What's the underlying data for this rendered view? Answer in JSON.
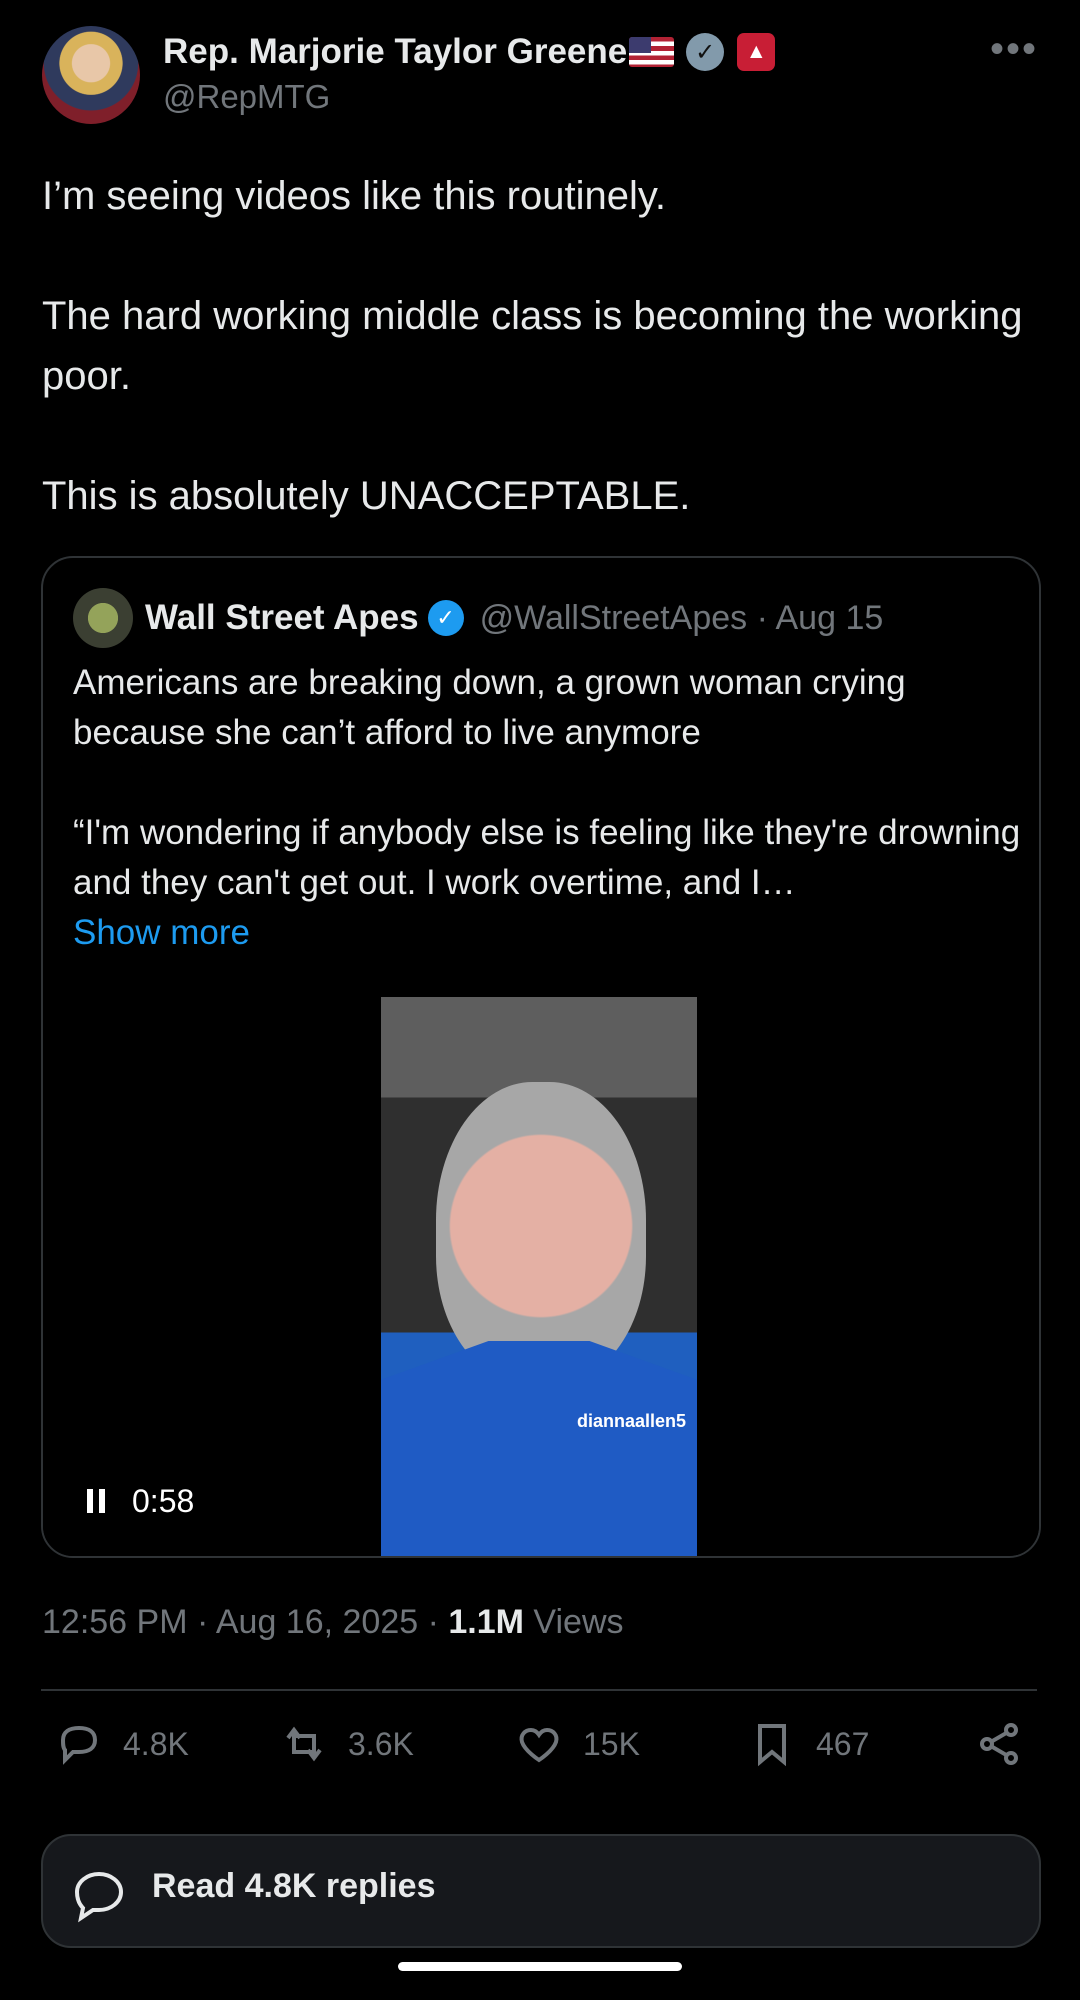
{
  "author": {
    "display_name": "Rep. Marjorie Taylor Greene",
    "handle": "@RepMTG"
  },
  "tweet": {
    "paragraphs": [
      "I’m seeing videos like this routinely.",
      "The hard working middle class is becoming the working poor.",
      "This is absolutely UNACCEPTABLE."
    ]
  },
  "quote": {
    "name": "Wall Street Apes",
    "meta": "@WallStreetApes · Aug 15",
    "paragraphs": [
      "Americans are breaking down, a grown woman crying because she can’t afford to live anymore",
      "“I'm wondering if anybody else is feeling like they're drowning and they can't get out. I work overtime, and I…"
    ],
    "show_more": "Show more",
    "video": {
      "watermark": "diannaallen5",
      "time": "0:58"
    }
  },
  "details": {
    "time_date": "12:56 PM · Aug 16, 2025 · ",
    "views_count": "1.1M",
    "views_label": " Views"
  },
  "actions": {
    "replies": "4.8K",
    "reposts": "3.6K",
    "likes": "15K",
    "bookmarks": "467"
  },
  "read_replies": "Read 4.8K replies",
  "icons": {
    "government_badge": "government-verification-icon",
    "capitol_badge": "capitol-icon",
    "verified": "verified-check-icon",
    "reply": "reply-icon",
    "repost": "repost-icon",
    "like": "like-icon",
    "bookmark": "bookmark-icon",
    "share": "share-icon"
  },
  "colors": {
    "background": "#000000",
    "text": "#e7e9ea",
    "muted": "#71767b",
    "accent": "#1d9bf0",
    "capitol_badge": "#c81e35"
  }
}
